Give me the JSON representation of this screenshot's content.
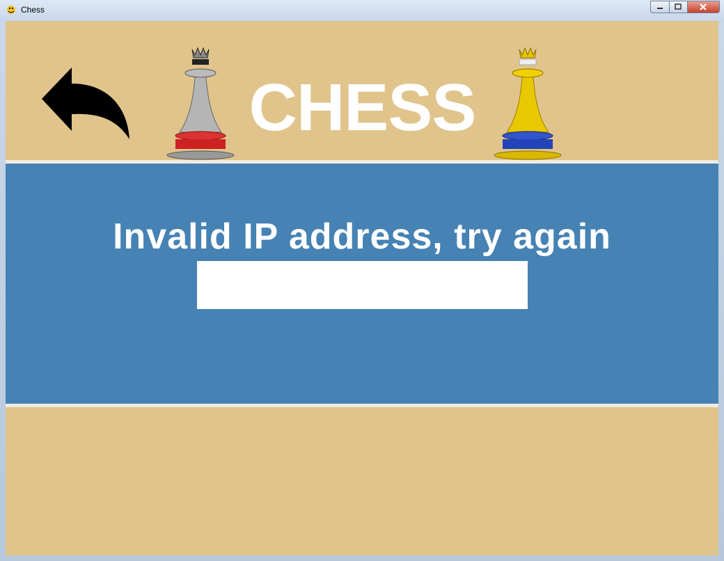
{
  "window": {
    "title": "Chess",
    "app_icon": "pygame-snake-icon",
    "buttons": [
      "minimize",
      "maximize",
      "close"
    ]
  },
  "header": {
    "title": "CHESS",
    "back_icon": "back-arrow-icon",
    "left_piece": "silver-red-queen-icon",
    "right_piece": "gold-blue-queen-icon"
  },
  "panel": {
    "message": "Invalid IP address, try again",
    "ip_input": {
      "value": "",
      "placeholder": ""
    }
  },
  "colors": {
    "background": "#e0c48b",
    "panel": "#4682b4",
    "text": "#ffffff",
    "divider": "#f0ece4"
  }
}
